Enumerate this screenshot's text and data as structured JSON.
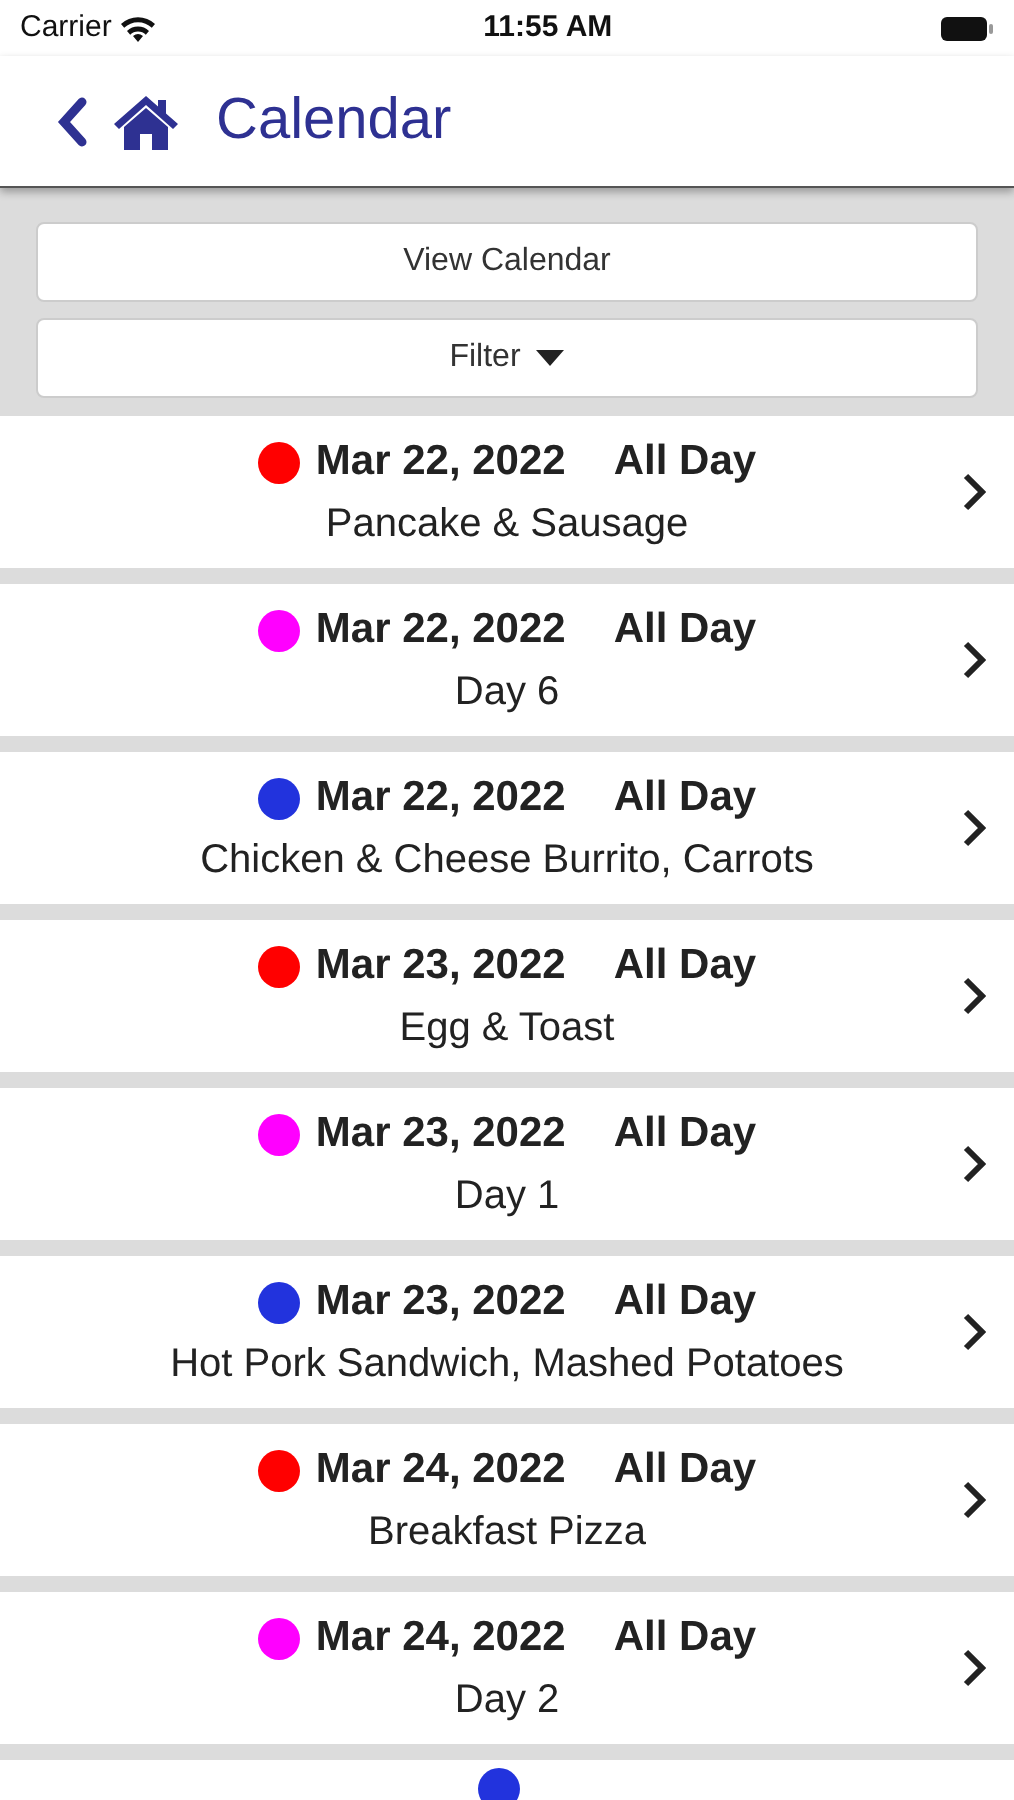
{
  "status_bar": {
    "carrier": "Carrier",
    "time": "11:55 AM"
  },
  "nav": {
    "title": "Calendar"
  },
  "buttons": {
    "view_calendar": "View Calendar",
    "filter": "Filter"
  },
  "events": [
    {
      "date": "Mar 22, 2022",
      "time": "All Day",
      "title": "Pancake & Sausage",
      "color": "#ff0000"
    },
    {
      "date": "Mar 22, 2022",
      "time": "All Day",
      "title": "Day 6",
      "color": "#ff00ff"
    },
    {
      "date": "Mar 22, 2022",
      "time": "All Day",
      "title": "Chicken & Cheese Burrito, Carrots",
      "color": "#2233dd"
    },
    {
      "date": "Mar 23, 2022",
      "time": "All Day",
      "title": "Egg & Toast",
      "color": "#ff0000"
    },
    {
      "date": "Mar 23, 2022",
      "time": "All Day",
      "title": "Day 1",
      "color": "#ff00ff"
    },
    {
      "date": "Mar 23, 2022",
      "time": "All Day",
      "title": "Hot Pork Sandwich, Mashed Potatoes",
      "color": "#2233dd"
    },
    {
      "date": "Mar 24, 2022",
      "time": "All Day",
      "title": "Breakfast Pizza",
      "color": "#ff0000"
    },
    {
      "date": "Mar 24, 2022",
      "time": "All Day",
      "title": "Day 2",
      "color": "#ff00ff"
    },
    {
      "color": "#2233dd"
    }
  ]
}
